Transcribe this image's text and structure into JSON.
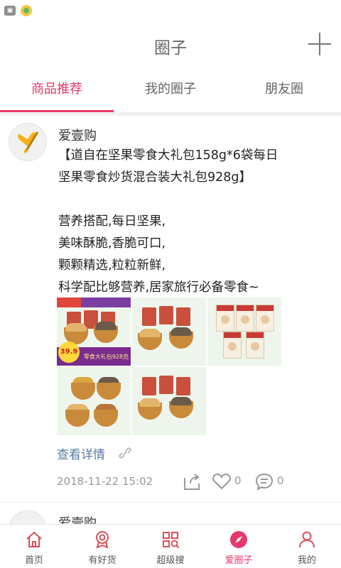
{
  "status_bar": {
    "icons": [
      "gallery-notification-icon",
      "app-notification-icon"
    ]
  },
  "header": {
    "title": "圈子",
    "add_icon": "plus-icon"
  },
  "tabs": [
    {
      "label": "商品推荐",
      "active": true
    },
    {
      "label": "我的圈子",
      "active": false
    },
    {
      "label": "朋友圈",
      "active": false
    }
  ],
  "post": {
    "author": "爱壹购",
    "text": "【道自在坚果零食大礼包158g*6袋每日坚果零食炒货混合装大礼包928g】\n\n营养搭配,每日坚果,\n美味酥脆,香脆可口,\n颗颗精选,粒粒新鲜,\n科学配比够营养,居家旅行必备零食~",
    "image_banner": {
      "price": "39.9",
      "caption": "零食大礼包928克"
    },
    "detail_link": "查看详情",
    "timestamp": "2018-11-22 15:02",
    "likes": "0",
    "comments": "0"
  },
  "next_post": {
    "author": "爱壹购"
  },
  "bottom_nav": [
    {
      "label": "首页",
      "icon": "home-icon",
      "active": false
    },
    {
      "label": "有好货",
      "icon": "badge-icon",
      "active": false
    },
    {
      "label": "超级搜",
      "icon": "grid-search-icon",
      "active": false
    },
    {
      "label": "爱圈子",
      "icon": "compass-icon",
      "active": true
    },
    {
      "label": "我的",
      "icon": "user-icon",
      "active": false
    }
  ],
  "colors": {
    "accent": "#e8386a",
    "link": "#5b7aa6",
    "muted": "#999999"
  }
}
